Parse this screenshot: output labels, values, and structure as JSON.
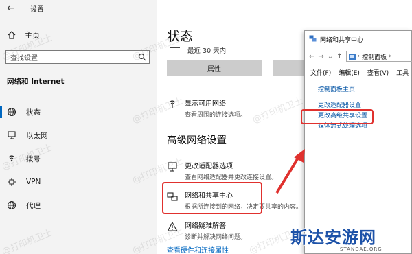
{
  "sidebar": {
    "title": "设置",
    "home_label": "主页",
    "search_placeholder": "查找设置",
    "section_label": "网络和 Internet",
    "items": [
      {
        "label": "状态",
        "icon": "globe-icon"
      },
      {
        "label": "以太网",
        "icon": "ethernet-icon"
      },
      {
        "label": "拨号",
        "icon": "dialup-icon"
      },
      {
        "label": "VPN",
        "icon": "vpn-icon"
      },
      {
        "label": "代理",
        "icon": "proxy-globe-icon"
      }
    ]
  },
  "main": {
    "title": "状态",
    "recent_text": "最近 30 天内",
    "properties_button": "属性",
    "show_networks": {
      "title": "显示可用网络",
      "desc": "查看周围的连接选项。"
    },
    "advanced_heading": "高级网络设置",
    "adapter_options": {
      "title": "更改适配器选项",
      "desc": "查看网络适配器并更改连接设置。"
    },
    "sharing_center": {
      "title": "网络和共享中心",
      "desc": "根据所连接到的网络，决定要共享的内容。"
    },
    "troubleshooter": {
      "title": "网络疑难解答",
      "desc": "诊断并解决网络问题。"
    },
    "hardware_link": "查看硬件和连接属性"
  },
  "window": {
    "title": "网络和共享中心",
    "address": "控制面板",
    "menu": [
      "文件(F)",
      "编辑(E)",
      "查看(V)",
      "工具"
    ],
    "home_link": "控制面板主页",
    "links": [
      "更改适配器设置",
      "更改高级共享设置",
      "媒体流式处理选项"
    ]
  },
  "watermark": "@打印机卫士",
  "brand": {
    "name": "斯达安游网",
    "sub": "STANDAE.ORG"
  },
  "colors": {
    "accent": "#0067c0",
    "highlight": "#e0312e",
    "brand": "#1d52a8"
  }
}
